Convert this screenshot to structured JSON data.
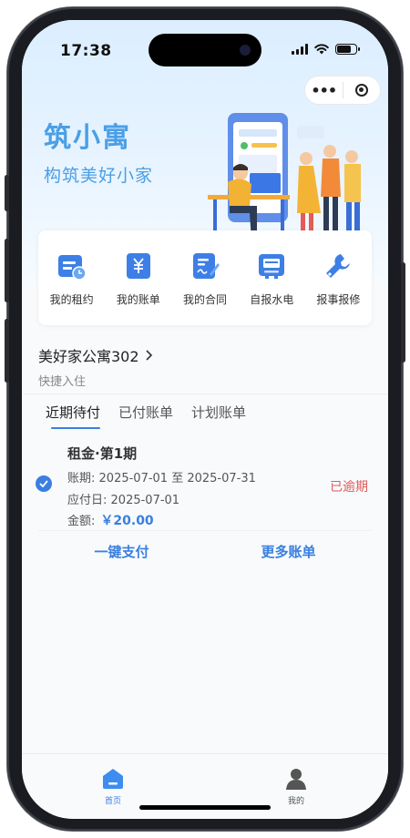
{
  "status": {
    "time": "17:38"
  },
  "capsule": {
    "more_icon": "more-icon",
    "close_icon": "close-circle-icon"
  },
  "brand": {
    "title": "筑小寓",
    "subtitle": "构筑美好小家"
  },
  "menu": [
    {
      "label": "我的租约",
      "icon": "lease-icon"
    },
    {
      "label": "我的账单",
      "icon": "bill-icon"
    },
    {
      "label": "我的合同",
      "icon": "contract-icon"
    },
    {
      "label": "自报水电",
      "icon": "meter-icon"
    },
    {
      "label": "报事报修",
      "icon": "wrench-icon"
    }
  ],
  "apartment": {
    "name": "美好家公寓302",
    "subtitle": "快捷入住"
  },
  "tabs": [
    {
      "label": "近期待付",
      "active": true
    },
    {
      "label": "已付账单",
      "active": false
    },
    {
      "label": "计划账单",
      "active": false
    }
  ],
  "bill": {
    "title": "租金·第1期",
    "period_label": "账期:",
    "period": "2025-07-01 至 2025-07-31",
    "due_label": "应付日:",
    "due": "2025-07-01",
    "amount_label": "金额:",
    "amount": "￥20.00",
    "status": "已逾期"
  },
  "actions": {
    "pay": "一键支付",
    "more": "更多账单"
  },
  "tabbar": [
    {
      "label": "首页",
      "icon": "home-icon",
      "active": true
    },
    {
      "label": "我的",
      "icon": "user-icon",
      "active": false
    }
  ],
  "colors": {
    "accent": "#3a7fe0",
    "brand": "#4a9fe6",
    "danger": "#e05a5a"
  }
}
